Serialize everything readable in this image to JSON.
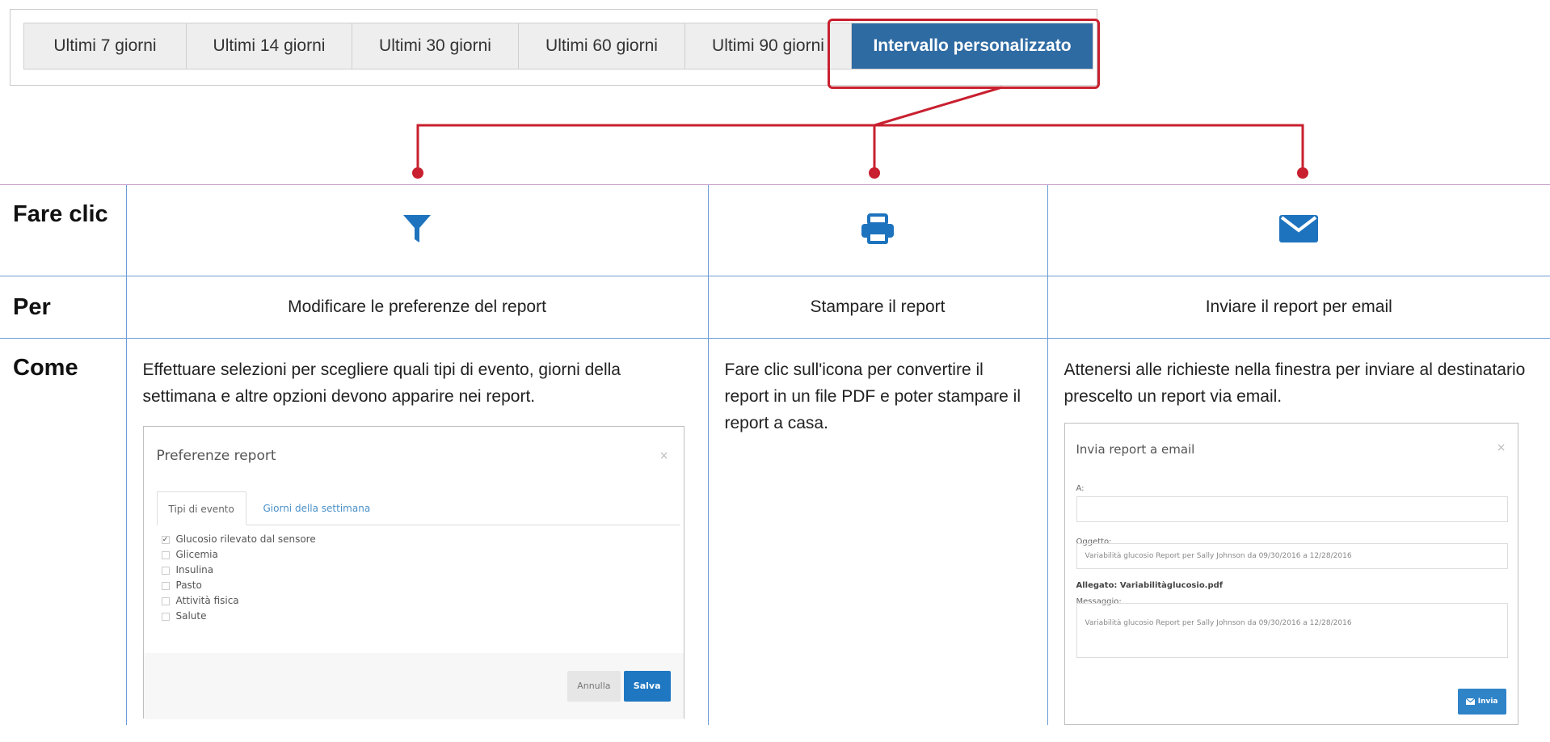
{
  "range_tabs": [
    {
      "label": "Ultimi 7 giorni",
      "active": false
    },
    {
      "label": "Ultimi 14 giorni",
      "active": false
    },
    {
      "label": "Ultimi 30 giorni",
      "active": false
    },
    {
      "label": "Ultimi 60 giorni",
      "active": false
    },
    {
      "label": "Ultimi 90 giorni",
      "active": false
    },
    {
      "label": "Intervallo personalizzato",
      "active": true
    }
  ],
  "colors": {
    "accent": "#2f6ba3",
    "highlight": "#c8202f",
    "icon_blue": "#1e73be",
    "grid_line": "#6a9bd4"
  },
  "table": {
    "rows": {
      "click": "Fare clic",
      "for": "Per",
      "how": "Come"
    },
    "columns": [
      {
        "icon": "filter-icon",
        "for": "Modificare le preferenze del report",
        "how": "Effettuare selezioni per scegliere quali tipi di evento, giorni della settimana e altre opzioni devono apparire nei report."
      },
      {
        "icon": "print-icon",
        "for": "Stampare il report",
        "how": "Fare clic sull'icona per convertire il report in un file PDF e poter stampare il report a casa."
      },
      {
        "icon": "envelope-icon",
        "for": "Inviare il report per email",
        "how": "Attenersi alle richieste nella finestra per inviare al destinatario prescelto un report via email."
      }
    ]
  },
  "pref_dialog": {
    "title": "Preferenze report",
    "close": "×",
    "tabs": [
      "Tipi di evento",
      "Giorni della settimana"
    ],
    "options": [
      {
        "label": "Glucosio rilevato dal sensore",
        "checked": true
      },
      {
        "label": "Glicemia",
        "checked": false
      },
      {
        "label": "Insulina",
        "checked": false
      },
      {
        "label": "Pasto",
        "checked": false
      },
      {
        "label": "Attività fisica",
        "checked": false
      },
      {
        "label": "Salute",
        "checked": false
      }
    ],
    "cancel": "Annulla",
    "save": "Salva"
  },
  "mail_dialog": {
    "title": "Invia report a email",
    "close": "×",
    "to_label": "A:",
    "to_value": "",
    "subject_label": "Oggetto:",
    "subject_value": "Variabilità glucosio Report per Sally Johnson da 09/30/2016 a 12/28/2016",
    "attachment": "Allegato: Variabilitàglucosio.pdf",
    "message_label": "Messaggio:",
    "message_value": "Variabilità glucosio Report per Sally Johnson da 09/30/2016 a 12/28/2016",
    "send": "Invia"
  }
}
